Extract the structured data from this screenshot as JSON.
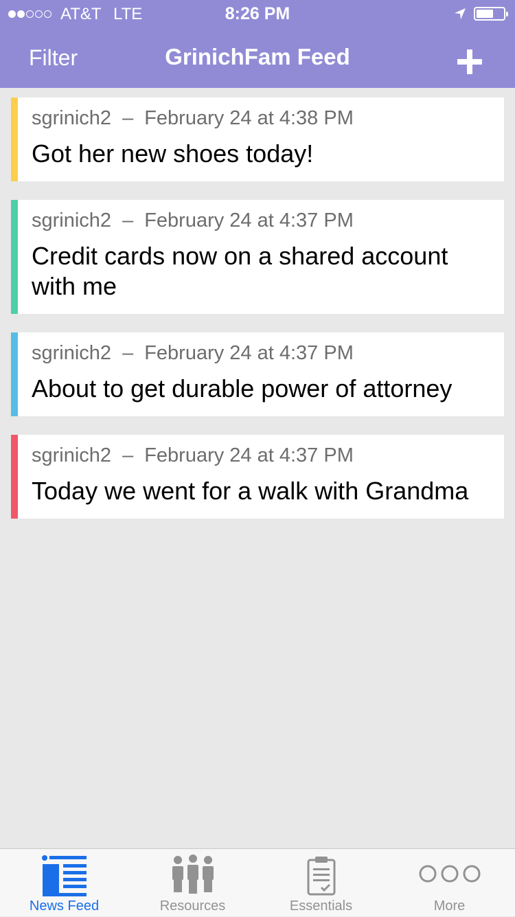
{
  "status_bar": {
    "carrier": "AT&T",
    "network": "LTE",
    "time": "8:26 PM"
  },
  "nav": {
    "filter_label": "Filter",
    "title": "GrinichFam Feed",
    "add_icon": "plus-icon"
  },
  "posts": [
    {
      "user": "sgrinich2",
      "separator": "–",
      "date": "February 24 at 4:38 PM",
      "text": "Got her new shoes today!",
      "color": "#fbcf4d"
    },
    {
      "user": "sgrinich2",
      "separator": "–",
      "date": "February 24 at 4:37 PM",
      "text": "Credit cards now on a shared account with me",
      "color": "#4dd0a8"
    },
    {
      "user": "sgrinich2",
      "separator": "–",
      "date": "February 24 at 4:37 PM",
      "text": "About to get durable power of attorney",
      "color": "#55bde6"
    },
    {
      "user": "sgrinich2",
      "separator": "–",
      "date": "February 24 at 4:37 PM",
      "text": "Today we went for a walk with Grandma",
      "color": "#f0596a"
    }
  ],
  "tabs": [
    {
      "label": "News Feed",
      "icon": "news-feed-icon",
      "active": true
    },
    {
      "label": "Resources",
      "icon": "people-icon",
      "active": false
    },
    {
      "label": "Essentials",
      "icon": "clipboard-icon",
      "active": false
    },
    {
      "label": "More",
      "icon": "more-icon",
      "active": false
    }
  ],
  "colors": {
    "header": "#918bd6",
    "active_tab": "#1a6fe8",
    "inactive_tab": "#929292"
  }
}
